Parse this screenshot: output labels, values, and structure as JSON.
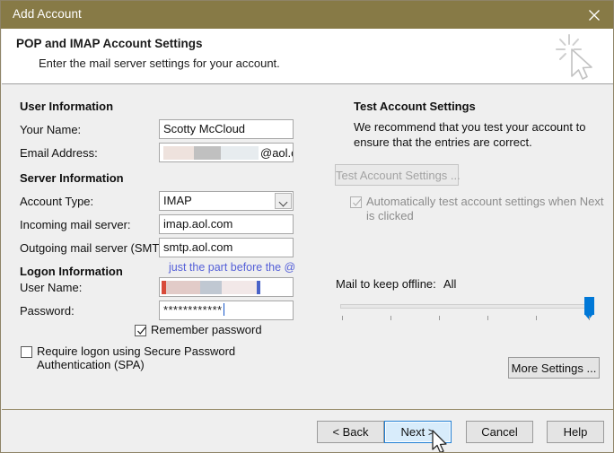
{
  "window": {
    "title": "Add Account",
    "close_icon": "close-icon",
    "titlebar_color": "#877a46"
  },
  "header": {
    "title": "POP and IMAP Account Settings",
    "subtitle": "Enter the mail server settings for your account.",
    "watermark_icon": "sparkle-cursor-icon"
  },
  "left_panel": {
    "user_information": {
      "group_label": "User Information",
      "your_name": {
        "label": "Your Name:",
        "value": "Scotty McCloud"
      },
      "email_address": {
        "label": "Email Address:",
        "value": "@aol.com",
        "redacted": true,
        "redaction_note": "username portion obscured"
      }
    },
    "server_information": {
      "group_label": "Server Information",
      "account_type": {
        "label": "Account Type:",
        "value": "IMAP",
        "icon": "chevron-down-icon"
      },
      "incoming_mail_server": {
        "label": "Incoming mail server:",
        "value": "imap.aol.com"
      },
      "outgoing_mail_server": {
        "label": "Outgoing mail server (SMTP):",
        "value": "smtp.aol.com"
      }
    },
    "logon_information": {
      "group_label": "Logon Information",
      "annotation": "just the part before the @",
      "annotation_color": "#5560d8",
      "user_name": {
        "label": "User Name:",
        "value": "",
        "redacted": true
      },
      "password": {
        "label": "Password:",
        "value": "************"
      },
      "remember_password": {
        "label": "Remember password",
        "checked": true
      },
      "require_spa": {
        "label": "Require logon using Secure Password Authentication (SPA)",
        "checked": false
      }
    }
  },
  "right_panel": {
    "group_label": "Test Account Settings",
    "description": "We recommend that you test your account to ensure that the entries are correct.",
    "test_button": {
      "label": "Test Account Settings ...",
      "disabled": true
    },
    "auto_test": {
      "label": "Automatically test account settings when Next is clicked",
      "label_line1": "Automatically test account settings when Next",
      "label_line2": "is clicked",
      "checked": true,
      "disabled": true
    },
    "mail_offline": {
      "label": "Mail to keep offline:",
      "value": "All",
      "slider_position_percent": 100,
      "tick_count": 6,
      "accent_color": "#0078d7"
    },
    "more_settings_button": {
      "label": "More Settings ..."
    }
  },
  "footer": {
    "back_button": {
      "label": "< Back"
    },
    "next_button": {
      "label": "Next >",
      "focused": true
    },
    "cancel_button": {
      "label": "Cancel"
    },
    "help_button": {
      "label": "Help"
    },
    "cursor_icon": "mouse-pointer-icon"
  }
}
